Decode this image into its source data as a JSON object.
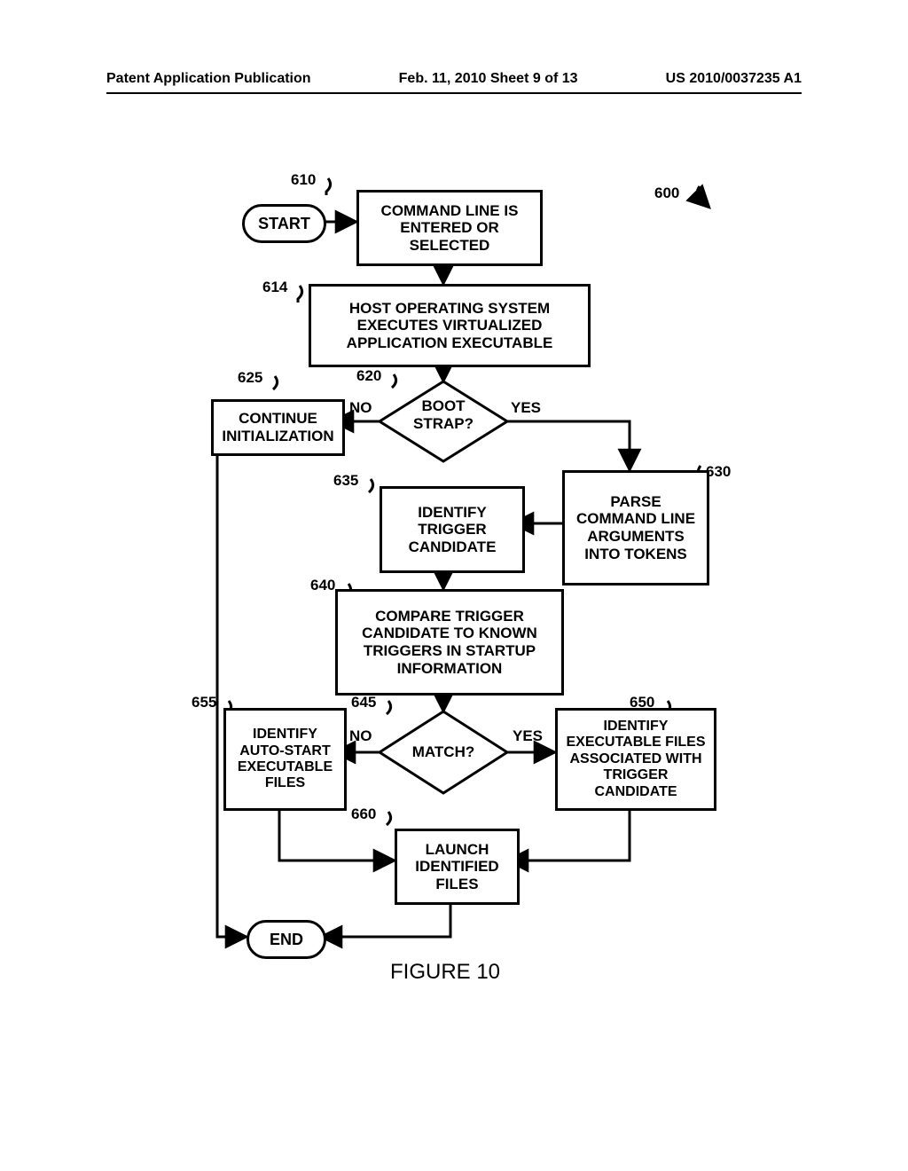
{
  "header": {
    "left": "Patent Application Publication",
    "center": "Feb. 11, 2010  Sheet 9 of 13",
    "right": "US 2010/0037235 A1"
  },
  "figure_caption": "FIGURE 10",
  "refs": {
    "overall": "600",
    "b610": "610",
    "b614": "614",
    "d620": "620",
    "b625": "625",
    "b630": "630",
    "b635": "635",
    "b640": "640",
    "d645": "645",
    "b650": "650",
    "b655": "655",
    "b660": "660"
  },
  "nodes": {
    "start": "START",
    "end": "END",
    "b610": "COMMAND LINE IS ENTERED OR SELECTED",
    "b614": "HOST OPERATING SYSTEM EXECUTES VIRTUALIZED APPLICATION EXECUTABLE",
    "d620": "BOOT STRAP?",
    "b625": "CONTINUE INITIALIZATION",
    "b630": "PARSE COMMAND LINE ARGUMENTS INTO TOKENS",
    "b635": "IDENTIFY TRIGGER CANDIDATE",
    "b640": "COMPARE TRIGGER CANDIDATE TO KNOWN TRIGGERS IN STARTUP INFORMATION",
    "d645": "MATCH?",
    "b650": "IDENTIFY EXECUTABLE FILES ASSOCIATED WITH TRIGGER CANDIDATE",
    "b655": "IDENTIFY AUTO-START EXECUTABLE FILES",
    "b660": "LAUNCH IDENTIFIED FILES"
  },
  "edge_labels": {
    "d620_no": "NO",
    "d620_yes": "YES",
    "d645_no": "NO",
    "d645_yes": "YES"
  }
}
